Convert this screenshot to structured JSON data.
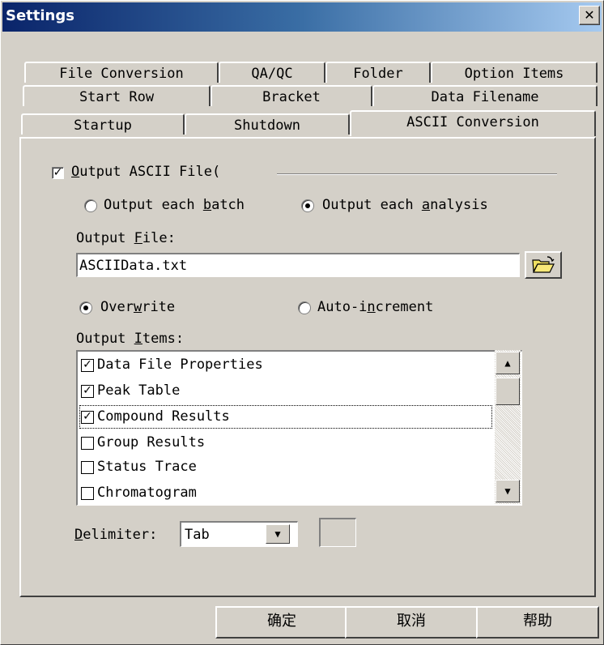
{
  "window": {
    "title": "Settings",
    "close_glyph": "✕"
  },
  "tabs": {
    "row1": [
      "File Conversion",
      "QA/QC",
      "Folder",
      "Option Items"
    ],
    "row2": [
      "Start Row",
      "Bracket",
      "Data Filename"
    ],
    "row3": [
      "Startup",
      "Shutdown",
      "ASCII Conversion"
    ],
    "active": "ASCII Conversion"
  },
  "output_ascii": {
    "label_pre": "",
    "label_ul": "O",
    "label_post": "utput ASCII File(",
    "checked": true
  },
  "output_mode": {
    "batch": {
      "pre": "Output each ",
      "ul": "b",
      "post": "atch",
      "selected": false
    },
    "analysis": {
      "pre": "Output each ",
      "ul": "a",
      "post": "nalysis",
      "selected": true
    }
  },
  "output_file": {
    "label_pre": "Output ",
    "label_ul": "F",
    "label_post": "ile:",
    "value": "ASCIIData.txt",
    "browse_icon": "folder-open-icon"
  },
  "write_mode": {
    "overwrite": {
      "pre": "Over",
      "ul": "w",
      "post": "rite",
      "selected": true
    },
    "autoinc": {
      "pre": "Auto-i",
      "ul": "n",
      "post": "crement",
      "selected": false
    }
  },
  "output_items": {
    "label_pre": "Output ",
    "label_ul": "I",
    "label_post": "tems:",
    "items": [
      {
        "label": "Data File Properties",
        "checked": true
      },
      {
        "label": "Peak Table",
        "checked": true
      },
      {
        "label": "Compound Results",
        "checked": true,
        "focused": true
      },
      {
        "label": "Group Results",
        "checked": false
      },
      {
        "label": "Status Trace",
        "checked": false
      },
      {
        "label": "Chromatogram",
        "checked": false
      }
    ]
  },
  "delimiter": {
    "label_ul": "D",
    "label_post": "elimiter:",
    "value": "Tab",
    "custom_value": ""
  },
  "buttons": {
    "ok": "确定",
    "cancel": "取消",
    "help": "帮助"
  }
}
